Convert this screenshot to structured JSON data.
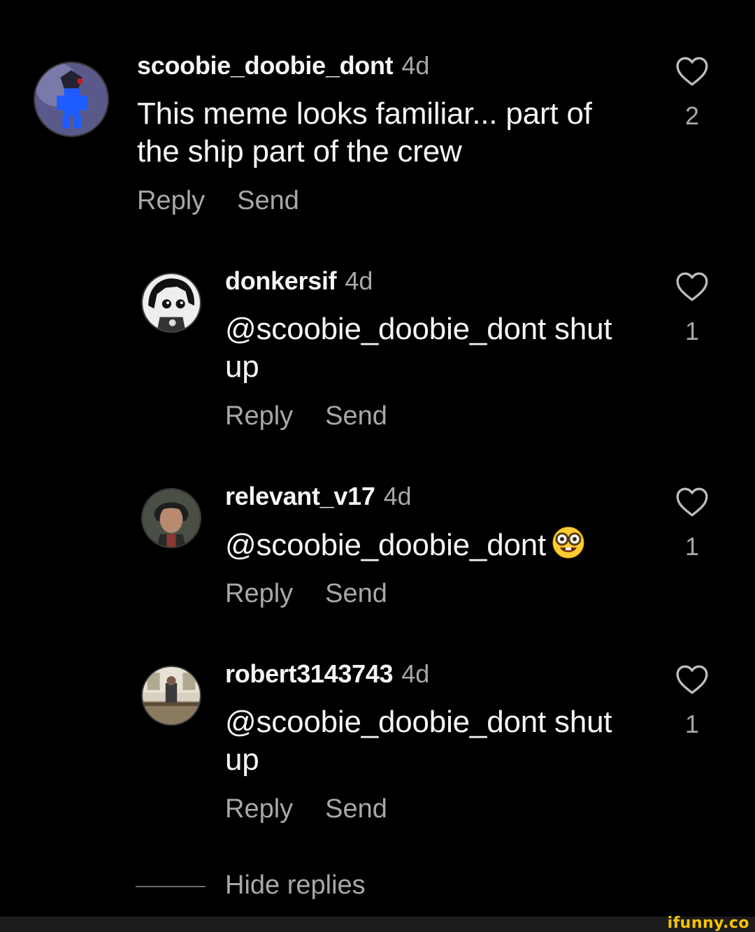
{
  "comments": [
    {
      "username": "scoobie_doobie_dont",
      "age": "4d",
      "text": "This meme looks familiar... part of the ship part of the crew",
      "reply_label": "Reply",
      "send_label": "Send",
      "like_count": "2"
    },
    {
      "username": "donkersif",
      "age": "4d",
      "text": "@scoobie_doobie_dont shut up",
      "reply_label": "Reply",
      "send_label": "Send",
      "like_count": "1"
    },
    {
      "username": "relevant_v17",
      "age": "4d",
      "text": "@scoobie_doobie_dont",
      "emoji": "nerd-face",
      "reply_label": "Reply",
      "send_label": "Send",
      "like_count": "1"
    },
    {
      "username": "robert3143743",
      "age": "4d",
      "text": "@scoobie_doobie_dont shut up",
      "reply_label": "Reply",
      "send_label": "Send",
      "like_count": "1"
    }
  ],
  "hide_replies_label": "Hide replies",
  "watermark": "ifunny.co",
  "colors": {
    "background": "#000000",
    "primary_text": "#f5f5f5",
    "secondary_text": "#a8a8a8",
    "watermark": "#f5c400"
  },
  "icons": {
    "like": "heart-outline-icon"
  }
}
